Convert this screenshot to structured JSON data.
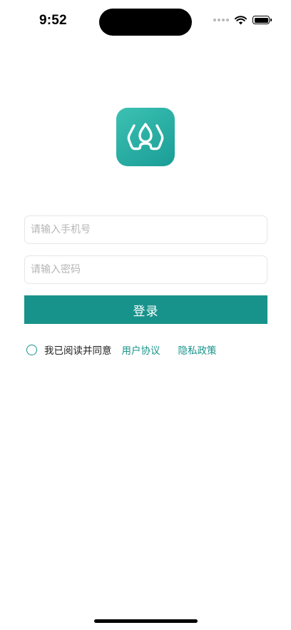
{
  "status_bar": {
    "time": "9:52",
    "icons": [
      "signal-dots-icon",
      "wifi-icon",
      "battery-icon"
    ]
  },
  "logo": {
    "icon": "droplet-in-sink-logo-icon",
    "background_colors": [
      "#3cc1b3",
      "#1a9d96"
    ]
  },
  "login_form": {
    "phone_placeholder": "请输入手机号",
    "phone_value": "",
    "password_placeholder": "请输入密码",
    "password_value": "",
    "submit_label": "登录"
  },
  "agreement": {
    "checked": false,
    "text": "我已阅读并同意",
    "user_agreement_link": "用户协议",
    "privacy_policy_link": "隐私政策"
  },
  "colors": {
    "accent": "#18938b",
    "input_border": "#e6e6e6",
    "placeholder": "#b5b5b5"
  }
}
